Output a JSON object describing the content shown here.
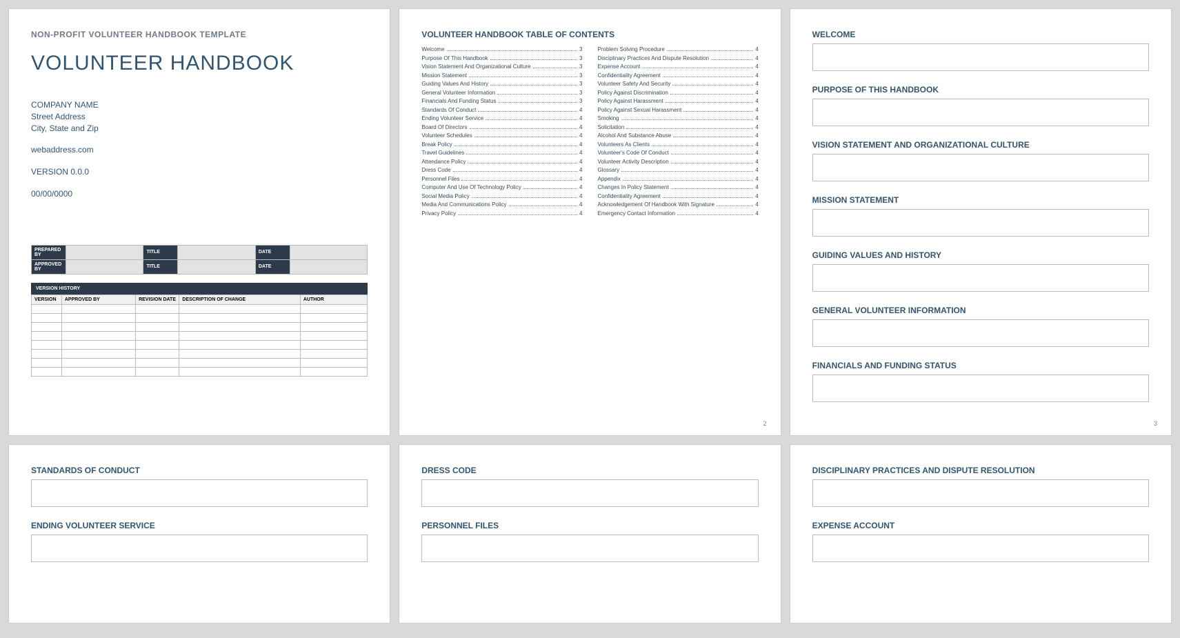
{
  "page1": {
    "subhead": "NON-PROFIT VOLUNTEER HANDBOOK TEMPLATE",
    "title": "VOLUNTEER HANDBOOK",
    "company": "COMPANY NAME",
    "street": "Street Address",
    "city": "City, State and Zip",
    "web": "webaddress.com",
    "version": "VERSION 0.0.0",
    "date": "00/00/0000",
    "signLabels": {
      "prepared": "PREPARED BY",
      "approved": "APPROVED BY",
      "title": "TITLE",
      "date": "DATE"
    },
    "versionHistory": {
      "header": "VERSION HISTORY",
      "cols": [
        "VERSION",
        "APPROVED BY",
        "REVISION DATE",
        "DESCRIPTION OF CHANGE",
        "AUTHOR"
      ]
    }
  },
  "page2": {
    "title": "VOLUNTEER HANDBOOK TABLE OF CONTENTS",
    "left": [
      {
        "t": "Welcome",
        "p": "3"
      },
      {
        "t": "Purpose Of This Handbook",
        "p": "3"
      },
      {
        "t": "Vision Statement And Organizational Culture",
        "p": "3"
      },
      {
        "t": "Mission Statement",
        "p": "3"
      },
      {
        "t": "Guiding Values And History",
        "p": "3"
      },
      {
        "t": "General Volunteer Information",
        "p": "3"
      },
      {
        "t": "Financials And Funding Status",
        "p": "3"
      },
      {
        "t": "Standards Of Conduct",
        "p": "4"
      },
      {
        "t": "Ending Volunteer Service",
        "p": "4"
      },
      {
        "t": "Board Of Directors",
        "p": "4"
      },
      {
        "t": "Volunteer Schedules",
        "p": "4"
      },
      {
        "t": "Break Policy",
        "p": "4"
      },
      {
        "t": "Travel Guidelines",
        "p": "4"
      },
      {
        "t": "Attendance Policy",
        "p": "4"
      },
      {
        "t": "Dress Code",
        "p": "4"
      },
      {
        "t": "Personnel Files",
        "p": "4"
      },
      {
        "t": "Computer And Use Of Technology Policy",
        "p": "4"
      },
      {
        "t": "Social Media Policy",
        "p": "4"
      },
      {
        "t": "Media And Communications Policy",
        "p": "4"
      },
      {
        "t": "Privacy Policy",
        "p": "4"
      }
    ],
    "right": [
      {
        "t": "Problem Solving Procedure",
        "p": "4"
      },
      {
        "t": "Disciplinary Practices And Dispute Resolution",
        "p": "4"
      },
      {
        "t": "Expense Account",
        "p": "4"
      },
      {
        "t": "Confidentiality Agreement",
        "p": "4"
      },
      {
        "t": "Volunteer Safety And Security",
        "p": "4"
      },
      {
        "t": "Policy Against Discrimination",
        "p": "4"
      },
      {
        "t": "Policy Against Harassment",
        "p": "4"
      },
      {
        "t": "Policy Against Sexual Harassment",
        "p": "4"
      },
      {
        "t": "Smoking",
        "p": "4"
      },
      {
        "t": "Solicitation",
        "p": "4"
      },
      {
        "t": "Alcohol And Substance Abuse",
        "p": "4"
      },
      {
        "t": "Volunteers As Clients",
        "p": "4"
      },
      {
        "t": "Volunteer's Code Of Conduct",
        "p": "4"
      },
      {
        "t": "Volunteer Activity Description",
        "p": "4"
      },
      {
        "t": "Glossary",
        "p": "4"
      },
      {
        "t": "Appendix",
        "p": "4"
      },
      {
        "t": "Changes In Policy Statement",
        "p": "4"
      },
      {
        "t": "Confidentiality Agreement",
        "p": "4"
      },
      {
        "t": "Acknowledgement Of Handbook With Signature",
        "p": "4"
      },
      {
        "t": "Emergency Contact Information",
        "p": "4"
      }
    ],
    "pagenum": "2"
  },
  "page3": {
    "sections": [
      "WELCOME",
      "PURPOSE OF THIS HANDBOOK",
      "VISION STATEMENT AND ORGANIZATIONAL CULTURE",
      "MISSION STATEMENT",
      "GUIDING VALUES AND HISTORY",
      "GENERAL VOLUNTEER INFORMATION",
      "FINANCIALS AND FUNDING STATUS"
    ],
    "pagenum": "3"
  },
  "page4": {
    "sections": [
      "STANDARDS OF CONDUCT",
      "ENDING VOLUNTEER SERVICE"
    ]
  },
  "page5": {
    "sections": [
      "DRESS CODE",
      "PERSONNEL FILES"
    ]
  },
  "page6": {
    "sections": [
      "DISCIPLINARY PRACTICES AND DISPUTE RESOLUTION",
      "EXPENSE ACCOUNT"
    ]
  }
}
